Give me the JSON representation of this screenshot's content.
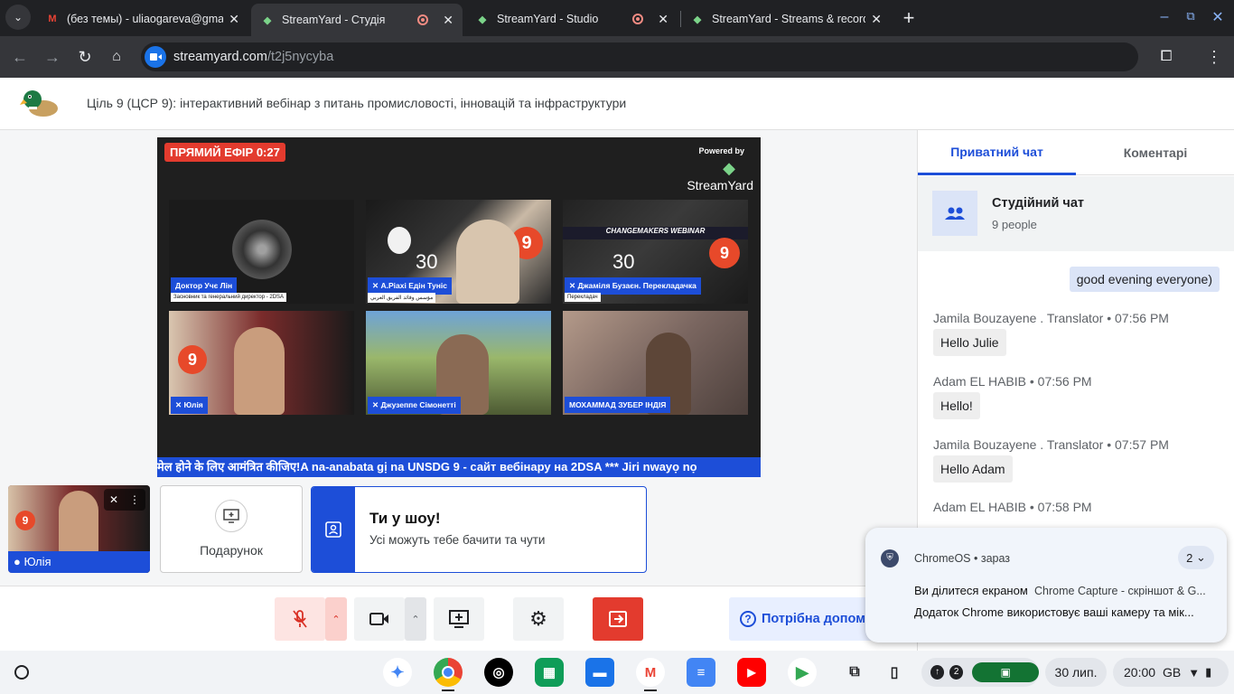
{
  "browser": {
    "tabs": [
      {
        "title": "(без темы) - uliaogareva@gma",
        "icon": "gmail-icon"
      },
      {
        "title": "StreamYard - Студія",
        "icon": "streamyard-icon",
        "recording": true
      },
      {
        "title": "StreamYard - Studio",
        "icon": "streamyard-icon",
        "recording": true
      },
      {
        "title": "StreamYard - Streams & record",
        "icon": "streamyard-icon"
      }
    ],
    "url_host": "streamyard.com",
    "url_path": "/t2j5nycyba"
  },
  "header": {
    "title": "Ціль 9 (ЦСР 9): інтерактивний вебінар з питань промисловості, інновацій та інфраструктури"
  },
  "stage": {
    "live_badge": "ПРЯМИЙ ЕФІР 0:27",
    "powered_by": "Powered by",
    "brand": "StreamYard",
    "ticker": "मेल होने के लिए आमंत्रित कीजिए!A na-anabata gị na UNSDG 9 - сайт вебінару на 2DSA *** Jiri nwayọ nọ",
    "participants": [
      {
        "name": "Доктор Учє Лін",
        "subtitle": "Засновник та генеральний директор - 2DSA",
        "muted": false
      },
      {
        "name": "А.Ріахі Едін Туніс",
        "subtitle": "مؤسس وقائد الفريق العربي",
        "muted": true
      },
      {
        "name": "Джаміля Бузаєн. Перекладачка",
        "subtitle": "Перекладач",
        "muted": true
      },
      {
        "name": "Юлія",
        "subtitle": "",
        "muted": true
      },
      {
        "name": "Джузеппе Сімонетті",
        "subtitle": "",
        "muted": true
      },
      {
        "name": "МОХАММАД ЗУБЕР ІНДІЯ",
        "subtitle": "",
        "muted": false
      }
    ]
  },
  "self": {
    "name": "Юлія"
  },
  "gift": {
    "label": "Подарунок"
  },
  "show": {
    "title": "Ти у шоу!",
    "subtitle": "Усі можуть тебе бачити та чути"
  },
  "controls": {
    "help_label": "Потрібна допом"
  },
  "chat": {
    "tabs": [
      "Приватний чат",
      "Коментарі"
    ],
    "room_title": "Студійний чат",
    "room_count": "9 people",
    "own_message": "good evening everyone)",
    "messages": [
      {
        "author": "Jamila Bouzayene . Translator",
        "time": "07:56 PM",
        "text": "Hello Julie"
      },
      {
        "author": "Adam EL HABIB",
        "time": "07:56 PM",
        "text": "Hello!"
      },
      {
        "author": "Jamila Bouzayene . Translator",
        "time": "07:57 PM",
        "text": "Hello Adam"
      },
      {
        "author": "Adam EL HABIB",
        "time": "07:58 PM",
        "text": ""
      }
    ]
  },
  "notification": {
    "source": "ChromeOS",
    "when": "зараз",
    "count": "2",
    "line1_bold": "Ви ділитеся екраном",
    "line1_rest": "Chrome Capture - скріншот & G...",
    "line2": "Додаток Chrome використовує ваші камеру та мік..."
  },
  "shelf": {
    "notif_count": "2",
    "date": "30 лип.",
    "time": "20:00",
    "locale": "GB"
  }
}
